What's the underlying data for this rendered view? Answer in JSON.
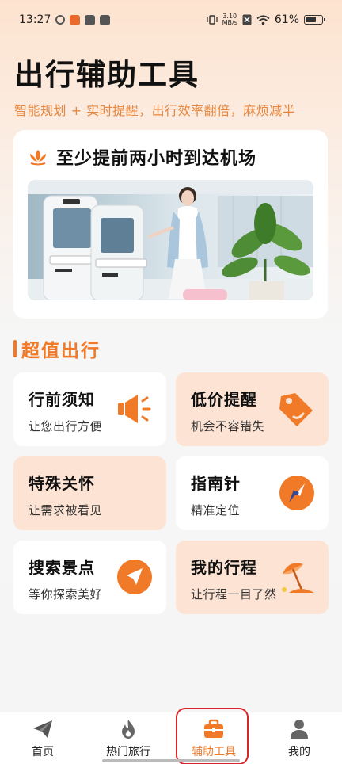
{
  "status_bar": {
    "time": "13:27",
    "speed_value": "3.10",
    "speed_unit": "MB/s",
    "battery": "61%"
  },
  "header": {
    "title": "出行辅助工具",
    "subtitle": "智能规划 + 实时提醒，出行效率翻倍，麻烦减半"
  },
  "banner": {
    "title": "至少提前两小时到达机场"
  },
  "section": {
    "title": "超值出行"
  },
  "tiles": [
    {
      "title": "行前须知",
      "subtitle": "让您出行方便",
      "icon": "megaphone-icon"
    },
    {
      "title": "低价提醒",
      "subtitle": "机会不容错失",
      "icon": "price-tag-icon"
    },
    {
      "title": "特殊关怀",
      "subtitle": "让需求被看见",
      "icon": ""
    },
    {
      "title": "指南针",
      "subtitle": "精准定位",
      "icon": "compass-icon"
    },
    {
      "title": "搜索景点",
      "subtitle": "等你探索美好",
      "icon": "navigation-arrow-icon"
    },
    {
      "title": "我的行程",
      "subtitle": "让行程一目了然",
      "icon": "beach-umbrella-icon"
    }
  ],
  "tab_bar": {
    "items": [
      {
        "label": "首页",
        "icon": "paper-plane-icon"
      },
      {
        "label": "热门旅行",
        "icon": "flame-icon"
      },
      {
        "label": "辅助工具",
        "icon": "toolbox-icon",
        "active": true
      },
      {
        "label": "我的",
        "icon": "user-icon"
      }
    ]
  },
  "colors": {
    "accent": "#f07a28",
    "subtitle": "#e8873f",
    "tile_peach": "#fde3d3",
    "highlight": "#d6262a"
  }
}
